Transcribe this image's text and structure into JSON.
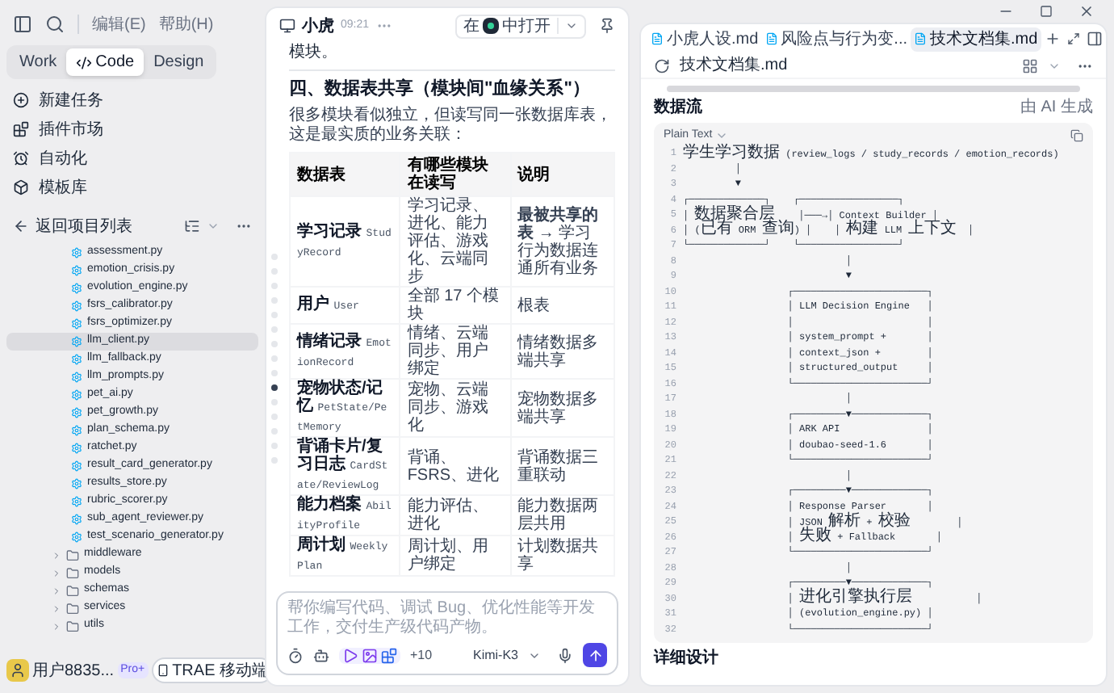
{
  "menu": {
    "items": [
      "编辑(E)",
      "帮助(H)"
    ]
  },
  "mode_tabs": [
    {
      "label": "Work",
      "selected": false
    },
    {
      "label": "Code",
      "selected": true
    },
    {
      "label": "Design",
      "selected": false
    }
  ],
  "nav": [
    {
      "label": "新建任务",
      "kind": "task"
    },
    {
      "label": "插件市场",
      "kind": "plugins"
    },
    {
      "label": "自动化",
      "kind": "automation"
    },
    {
      "label": "模板库",
      "kind": "templates"
    }
  ],
  "project": {
    "back_label": "返回项目列表",
    "files": [
      {
        "label": "assessment.py",
        "selected": false
      },
      {
        "label": "emotion_crisis.py",
        "selected": false
      },
      {
        "label": "evolution_engine.py",
        "selected": false
      },
      {
        "label": "fsrs_calibrator.py",
        "selected": false
      },
      {
        "label": "fsrs_optimizer.py",
        "selected": false
      },
      {
        "label": "llm_client.py",
        "selected": true
      },
      {
        "label": "llm_fallback.py",
        "selected": false
      },
      {
        "label": "llm_prompts.py",
        "selected": false
      },
      {
        "label": "pet_ai.py",
        "selected": false
      },
      {
        "label": "pet_growth.py",
        "selected": false
      },
      {
        "label": "plan_schema.py",
        "selected": false
      },
      {
        "label": "ratchet.py",
        "selected": false
      },
      {
        "label": "result_card_generator.py",
        "selected": false
      },
      {
        "label": "results_store.py",
        "selected": false
      },
      {
        "label": "rubric_scorer.py",
        "selected": false
      },
      {
        "label": "sub_agent_reviewer.py",
        "selected": false
      },
      {
        "label": "test_scenario_generator.py",
        "selected": false
      }
    ],
    "folders": [
      {
        "label": "middleware",
        "expanded": false
      },
      {
        "label": "models",
        "expanded": false
      },
      {
        "label": "schemas",
        "expanded": false
      },
      {
        "label": "services",
        "expanded": false
      },
      {
        "label": "utils",
        "expanded": false
      }
    ]
  },
  "user": {
    "name": "用户8835...",
    "badge": "Pro+",
    "mobile_button": "TRAE 移动端"
  },
  "chat": {
    "agent": "小虎",
    "time": "09:21",
    "open_in": {
      "prefix": "在",
      "suffix": "中打开"
    },
    "outline_dots": [
      {
        "selected": false
      },
      {
        "selected": false
      },
      {
        "selected": false
      },
      {
        "selected": false
      },
      {
        "selected": false
      },
      {
        "selected": false
      },
      {
        "selected": false
      },
      {
        "selected": false
      },
      {
        "selected": false
      },
      {
        "selected": true
      },
      {
        "selected": false
      },
      {
        "selected": false
      },
      {
        "selected": false
      },
      {
        "selected": false
      },
      {
        "selected": false
      }
    ],
    "content": {
      "tail": "模块。",
      "heading": "四、数据表共享（模块间\"血缘关系\"）",
      "intro": "很多模块看似独立，但读写同一张数据库表，这是最实质的业务关联：",
      "table": {
        "columns": [
          "数据表",
          "有哪些模块在读写",
          "说明"
        ],
        "rows": [
          {
            "name": "学习记录",
            "code": "StudyRecord",
            "modules": "学习记录、进化、能力评估、游戏化、云端同步",
            "note": "**最被共享的表** → 学习行为数据连通所有业务"
          },
          {
            "name": "用户",
            "code": "User",
            "modules": "全部 17 个模块",
            "note": "根表"
          },
          {
            "name": "情绪记录",
            "code": "EmotionRecord",
            "modules": "情绪、云端同步、用户绑定",
            "note": "情绪数据多端共享"
          },
          {
            "name": "宠物状态/记忆",
            "code": "PetState/PetMemory",
            "modules": "宠物、云端同步、游戏化",
            "note": "宠物数据多端共享"
          },
          {
            "name": "背诵卡片/复习日志",
            "code": "CardState/ReviewLog",
            "modules": "背诵、FSRS、进化",
            "note": "背诵数据三重联动"
          },
          {
            "name": "能力档案",
            "code": "AbilityProfile",
            "modules": "能力评估、进化",
            "note": "能力数据两层共用"
          },
          {
            "name": "周计划",
            "code": "WeeklyPlan",
            "modules": "周计划、用户绑定",
            "note": "计划数据共享"
          }
        ]
      }
    },
    "input": {
      "placeholder": "帮你编写代码、调试 Bug、优化性能等开发工作，交付生产级代码产物。",
      "extra_count": "+10",
      "model": "Kimi-K3"
    }
  },
  "editor": {
    "tabs": [
      {
        "label": "小虎人设.md",
        "selected": false
      },
      {
        "label": "风险点与行为变...",
        "selected": false
      },
      {
        "label": "技术文档集.md",
        "selected": true
      }
    ],
    "file_title": "技术文档集.md",
    "ai_note": "由 AI 生成",
    "section": "数据流",
    "code": {
      "language": "Plain Text",
      "lines": [
        {
          "n": "1",
          "text": "学生学习数据 (review_logs / study_records / emotion_records)"
        },
        {
          "n": "2",
          "text": "         │"
        },
        {
          "n": "3",
          "text": "         ▼"
        },
        {
          "n": "4",
          "text": "┌─────────────┐    ┌─────────────────┐"
        },
        {
          "n": "5",
          "text": "│ 数据聚合层    │───→│ Context Builder │"
        },
        {
          "n": "6",
          "text": "│ (已有 ORM 查询) │    │ 构建 LLM 上下文  │"
        },
        {
          "n": "7",
          "text": "└─────────────┘    └─────────────────┘"
        },
        {
          "n": "8",
          "text": "                            │"
        },
        {
          "n": "9",
          "text": "                            ▼"
        },
        {
          "n": "10",
          "text": "                  ┌───────────────────────┐"
        },
        {
          "n": "11",
          "text": "                  │ LLM Decision Engine   │"
        },
        {
          "n": "12",
          "text": "                  │                       │"
        },
        {
          "n": "13",
          "text": "                  │ system_prompt +       │"
        },
        {
          "n": "14",
          "text": "                  │ context_json +        │"
        },
        {
          "n": "15",
          "text": "                  │ structured_output     │"
        },
        {
          "n": "16",
          "text": "                  └───────────────────────┘"
        },
        {
          "n": "17",
          "text": "                            │"
        },
        {
          "n": "18",
          "text": "                  ┌─────────▼─────────────┐"
        },
        {
          "n": "19",
          "text": "                  │ ARK API               │"
        },
        {
          "n": "20",
          "text": "                  │ doubao-seed-1.6       │"
        },
        {
          "n": "21",
          "text": "                  └───────────────────────┘"
        },
        {
          "n": "22",
          "text": "                            │"
        },
        {
          "n": "23",
          "text": "                  ┌─────────▼─────────────┐"
        },
        {
          "n": "24",
          "text": "                  │ Response Parser       │"
        },
        {
          "n": "25",
          "text": "                  │ JSON 解析 + 校验        │"
        },
        {
          "n": "26",
          "text": "                  │ 失败 + Fallback       │"
        },
        {
          "n": "27",
          "text": "                  └───────────────────────┘"
        },
        {
          "n": "28",
          "text": "                            │"
        },
        {
          "n": "29",
          "text": "                  ┌─────────▼─────────────┐"
        },
        {
          "n": "30",
          "text": "                  │ 进化引擎执行层           │"
        },
        {
          "n": "31",
          "text": "                  │ (evolution_engine.py) │"
        },
        {
          "n": "32",
          "text": "                  └───────────────────────┘"
        }
      ]
    },
    "next_section": "详细设计"
  }
}
